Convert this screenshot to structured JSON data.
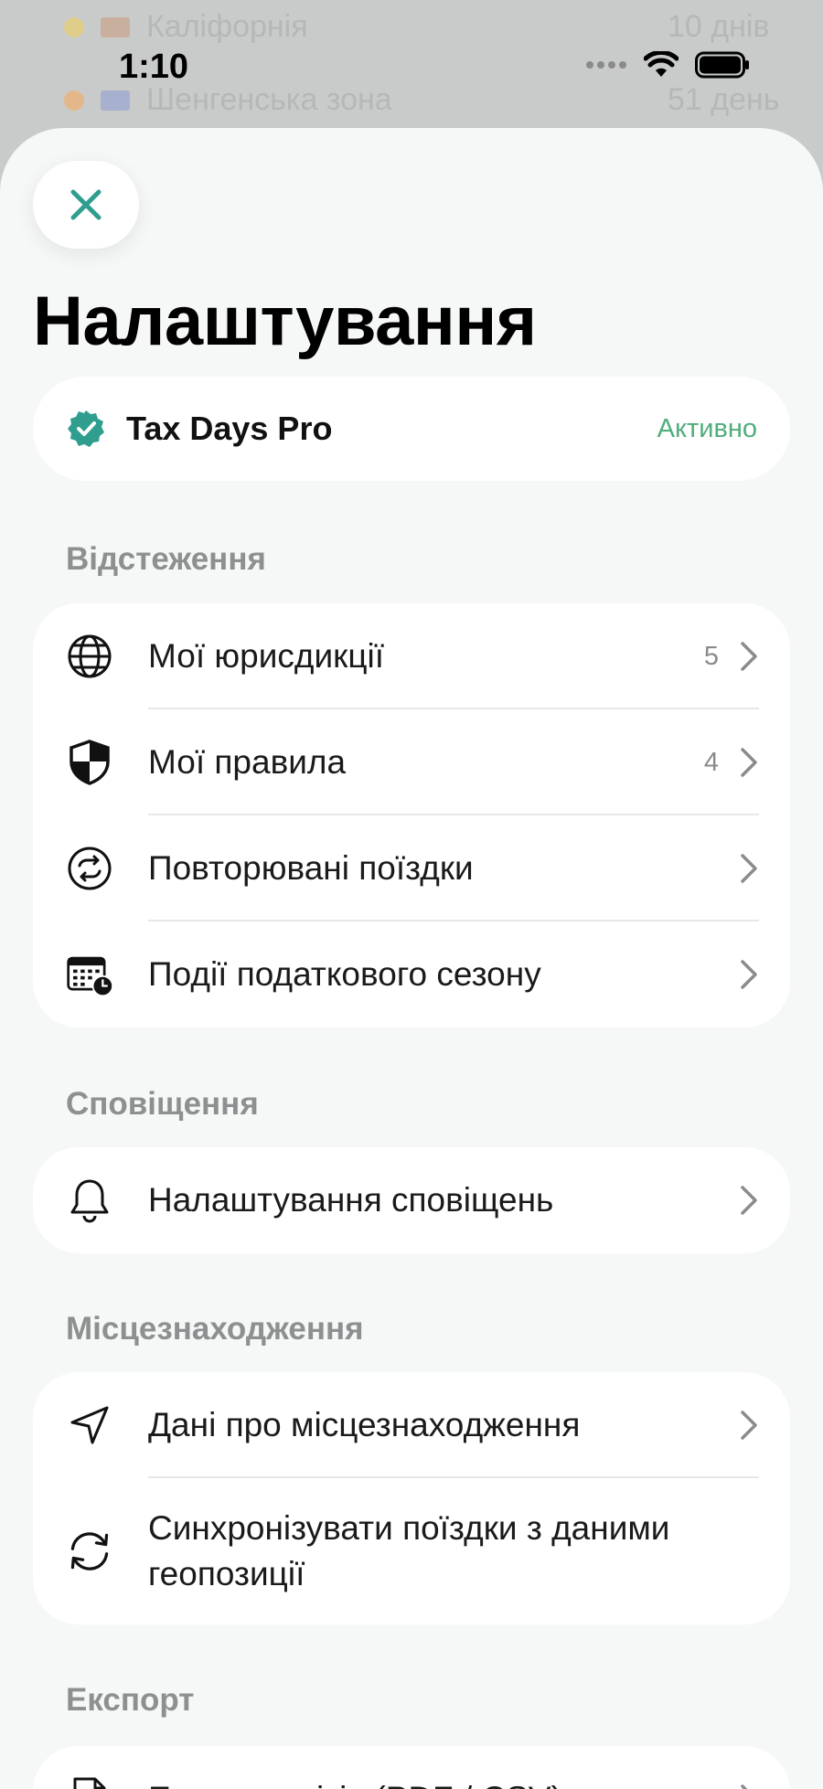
{
  "background": {
    "rows": [
      {
        "text": "Каліфорнія",
        "right": "10 днів"
      },
      {
        "text": "Шенгенська зона",
        "right": "51 день"
      }
    ]
  },
  "status_bar": {
    "time": "1:10"
  },
  "header": {
    "title": "Налаштування"
  },
  "pro": {
    "title": "Tax Days Pro",
    "status": "Активно",
    "accent": "#2f9e8f"
  },
  "sections": {
    "tracking": {
      "label": "Відстеження",
      "items": [
        {
          "label": "Мої юрисдикції",
          "count": "5",
          "icon": "globe-icon"
        },
        {
          "label": "Мої правила",
          "count": "4",
          "icon": "shield-icon"
        },
        {
          "label": "Повторювані поїздки",
          "count": "",
          "icon": "repeat-icon"
        },
        {
          "label": "Події податкового сезону",
          "count": "",
          "icon": "calendar-clock-icon"
        }
      ]
    },
    "notifications": {
      "label": "Сповіщення",
      "items": [
        {
          "label": "Налаштування сповіщень",
          "icon": "bell-icon"
        }
      ]
    },
    "location": {
      "label": "Місцезнаходження",
      "items": [
        {
          "label": "Дані про місцезнаходження",
          "icon": "location-arrow-icon"
        },
        {
          "label": "Синхронізувати поїздки з даними геопозиції",
          "icon": "sync-icon"
        }
      ]
    },
    "export": {
      "label": "Експорт",
      "items": [
        {
          "label": "Експорт звітів (PDF / CSV)",
          "icon": "document-icon"
        }
      ]
    }
  }
}
